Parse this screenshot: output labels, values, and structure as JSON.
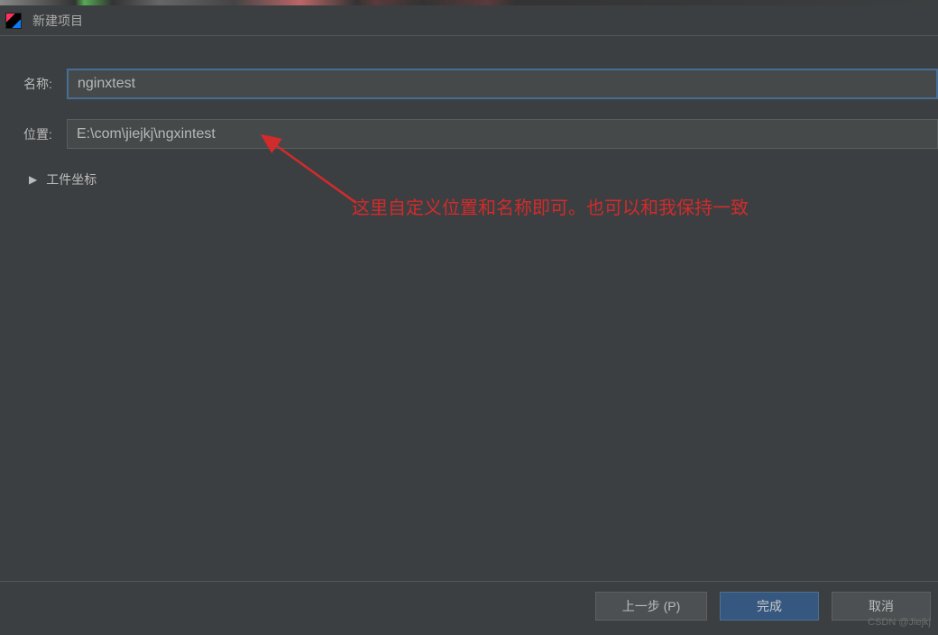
{
  "title": "新建项目",
  "form": {
    "name_label": "名称:",
    "name_value": "nginxtest",
    "location_label": "位置:",
    "location_value": "E:\\com\\jiejkj\\ngxintest"
  },
  "collapse": {
    "label": "工件坐标"
  },
  "annotation": {
    "text": "这里自定义位置和名称即可。也可以和我保持一致"
  },
  "footer": {
    "previous": "上一步 (P)",
    "finish": "完成",
    "cancel": "取消"
  },
  "watermark": "CSDN @Jiejkj"
}
